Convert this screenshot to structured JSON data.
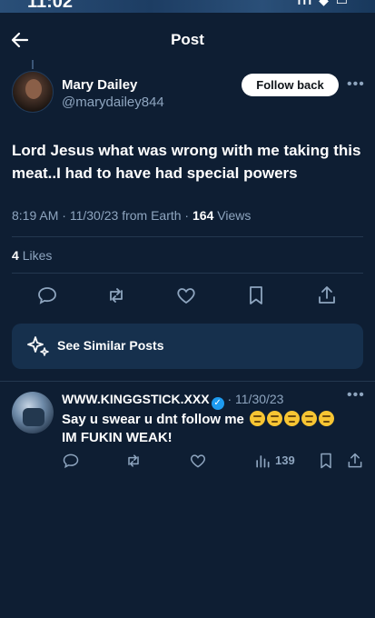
{
  "status_bar": {
    "time": "11:02",
    "icons": "ııl ◆ ▭"
  },
  "header": {
    "title": "Post"
  },
  "post": {
    "author_name": "Mary Dailey",
    "author_handle": "@marydailey844",
    "follow_label": "Follow back",
    "text": "Lord Jesus what was wrong with me taking this meat..I had to have had special powers",
    "time": "8:19 AM",
    "date": "11/30/23",
    "source": "from Earth",
    "views": "164",
    "views_label": "Views",
    "likes": "4",
    "likes_label": "Likes"
  },
  "similar": {
    "label": "See Similar Posts"
  },
  "reply": {
    "author_name": "WWW.KINGGSTICK.XXX",
    "date": "11/30/23",
    "line1": "Say u swear u dnt follow me",
    "line2": "IM FUKIN WEAK!",
    "views": "139"
  },
  "colors": {
    "background": "#0e1e33",
    "muted": "#8ea5bf",
    "verified": "#1d9bf0",
    "card": "#16304d"
  }
}
